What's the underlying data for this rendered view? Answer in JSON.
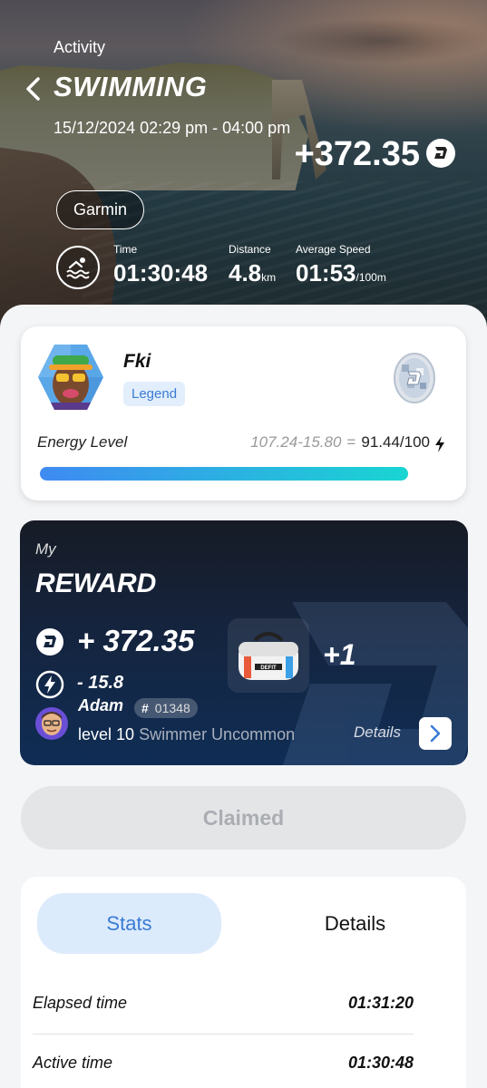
{
  "header": {
    "section_label": "Activity",
    "title": "SWIMMING",
    "datetime": "15/12/2024 02:29 pm - 04:00 pm",
    "earned": "+372.35",
    "source": "Garmin"
  },
  "metrics": [
    {
      "label": "Time",
      "value": "01:30:48",
      "unit": ""
    },
    {
      "label": "Distance",
      "value": "4.8",
      "unit": "km"
    },
    {
      "label": "Average Speed",
      "value": "01:53",
      "unit": "/100m"
    }
  ],
  "profile": {
    "name": "Fki",
    "badge": "Legend",
    "energy_label": "Energy Level",
    "energy_calc": "107.24-15.80",
    "energy_eq": "=",
    "energy_result": "91.44/100",
    "energy_fraction": 0.9144
  },
  "reward": {
    "my": "My",
    "title": "REWARD",
    "amount": "+ 372.35",
    "energy": "- 15.8",
    "item_count": "+1",
    "bag_label": "DEFIT",
    "user_name": "Adam",
    "user_id_hash": "#",
    "user_id": "01348",
    "level": "level 10",
    "tier": "Swimmer Uncommon",
    "details_label": "Details"
  },
  "claim_button": "Claimed",
  "tabs": [
    {
      "label": "Stats",
      "active": true
    },
    {
      "label": "Details",
      "active": false
    }
  ],
  "stats": [
    {
      "label": "Elapsed time",
      "value": "01:31:20"
    },
    {
      "label": "Active time",
      "value": "01:30:48"
    }
  ],
  "colors": {
    "accent_blue": "#3a7bd5",
    "bar_start": "#3f8af2",
    "bar_end": "#19d5d2",
    "reward_bg": "#15243e"
  }
}
